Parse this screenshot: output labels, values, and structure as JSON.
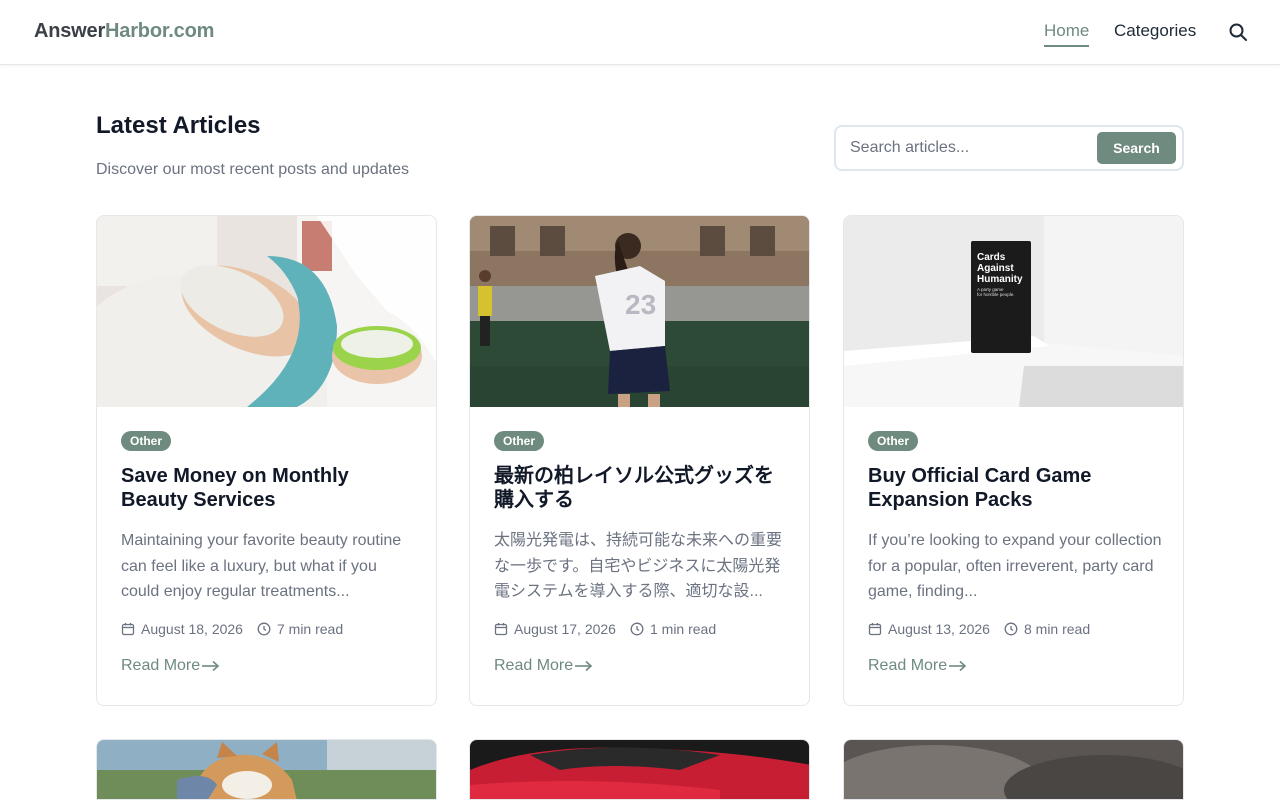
{
  "header": {
    "logo_part1": "Answer",
    "logo_part2": "Harbor.com",
    "nav_home": "Home",
    "nav_categories": "Categories"
  },
  "intro": {
    "title": "Latest Articles",
    "subtitle": "Discover our most recent posts and updates"
  },
  "search": {
    "placeholder": "Search articles...",
    "button": "Search"
  },
  "articles": [
    {
      "category": "Other",
      "title": "Save Money on Monthly Beauty Services",
      "excerpt": "Maintaining your favorite beauty routine can feel like a luxury, but what if you could enjoy regular treatments...",
      "date": "August 18, 2026",
      "read_time": "7 min read",
      "read_more": "Read More"
    },
    {
      "category": "Other",
      "title": "最新の柏レイソル公式グッズを購入する",
      "excerpt": "太陽光発電は、持続可能な未来への重要な一歩です。自宅やビジネスに太陽光発電システムを導入する際、適切な設...",
      "date": "August 17, 2026",
      "read_time": "1 min read",
      "read_more": "Read More"
    },
    {
      "category": "Other",
      "title": "Buy Official Card Game Expansion Packs",
      "excerpt": "If you’re looking to expand your collection for a popular, often irreverent, party card game, finding...",
      "date": "August 13, 2026",
      "read_time": "8 min read",
      "read_more": "Read More"
    }
  ],
  "card3_box_text": {
    "line1": "Cards",
    "line2": "Against",
    "line3": "Humanity",
    "tagline1": "A party game",
    "tagline2": "for horrible people."
  },
  "colors": {
    "accent": "#6f8a7f",
    "text": "#111827",
    "muted": "#6b7280"
  }
}
